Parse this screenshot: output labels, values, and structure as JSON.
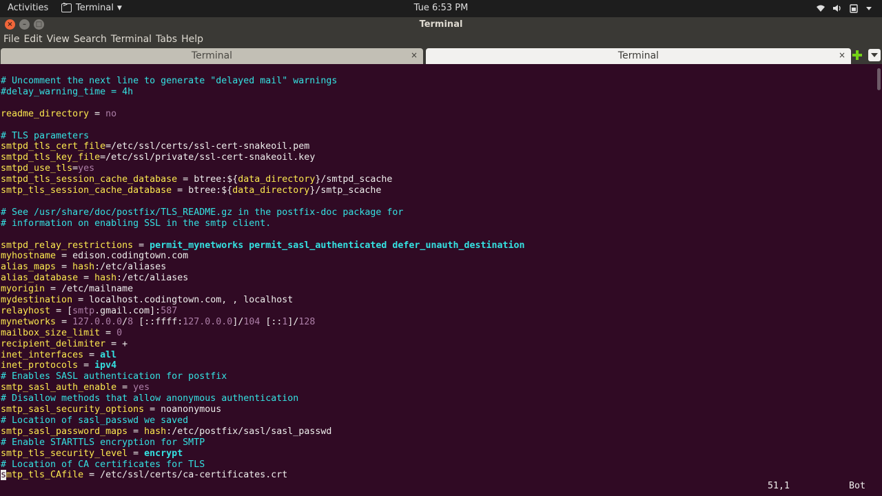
{
  "topbar": {
    "activities": "Activities",
    "app_name": "Terminal",
    "clock": "Tue  6:53 PM"
  },
  "window": {
    "title": "Terminal"
  },
  "menu": [
    "File",
    "Edit",
    "View",
    "Search",
    "Terminal",
    "Tabs",
    "Help"
  ],
  "tabs": [
    {
      "label": "Terminal",
      "active": false
    },
    {
      "label": "Terminal",
      "active": true
    }
  ],
  "editor": {
    "lines": [
      [
        [
          "c",
          "# Uncomment the next line to generate \"delayed mail\" warnings"
        ]
      ],
      [
        [
          "c",
          "#delay_warning_time = 4h"
        ]
      ],
      [],
      [
        [
          "k",
          "readme_directory"
        ],
        [
          "w",
          " = "
        ],
        [
          "g",
          "no"
        ]
      ],
      [],
      [
        [
          "c",
          "# TLS parameters"
        ]
      ],
      [
        [
          "k",
          "smtpd_tls_cert_file"
        ],
        [
          "w",
          "=/etc/ssl/certs/ssl-cert-snakeoil.pem"
        ]
      ],
      [
        [
          "k",
          "smtpd_tls_key_file"
        ],
        [
          "w",
          "=/etc/ssl/private/ssl-cert-snakeoil.key"
        ]
      ],
      [
        [
          "k",
          "smtpd_use_tls"
        ],
        [
          "w",
          "="
        ],
        [
          "g",
          "yes"
        ]
      ],
      [
        [
          "k",
          "smtpd_tls_session_cache_database"
        ],
        [
          "w",
          " = btree:${"
        ],
        [
          "k",
          "data_directory"
        ],
        [
          "w",
          "}/smtpd_scache"
        ]
      ],
      [
        [
          "k",
          "smtp_tls_session_cache_database"
        ],
        [
          "w",
          " = btree:${"
        ],
        [
          "k",
          "data_directory"
        ],
        [
          "w",
          "}/smtp_scache"
        ]
      ],
      [],
      [
        [
          "c",
          "# See /usr/share/doc/postfix/TLS_README.gz in the postfix-doc package for"
        ]
      ],
      [
        [
          "c",
          "# information on enabling SSL in the smtp client."
        ]
      ],
      [],
      [
        [
          "k",
          "smtpd_relay_restrictions"
        ],
        [
          "w",
          " = "
        ],
        [
          "bc",
          "permit_mynetworks permit_sasl_authenticated defer_unauth_destination"
        ]
      ],
      [
        [
          "k",
          "myhostname"
        ],
        [
          "w",
          " = edison.codingtown.com"
        ]
      ],
      [
        [
          "k",
          "alias_maps"
        ],
        [
          "w",
          " = "
        ],
        [
          "k",
          "hash"
        ],
        [
          "w",
          ":/etc/aliases"
        ]
      ],
      [
        [
          "k",
          "alias_database"
        ],
        [
          "w",
          " = "
        ],
        [
          "k",
          "hash"
        ],
        [
          "w",
          ":/etc/aliases"
        ]
      ],
      [
        [
          "k",
          "myorigin"
        ],
        [
          "w",
          " = /etc/mailname"
        ]
      ],
      [
        [
          "k",
          "mydestination"
        ],
        [
          "w",
          " = localhost.codingtown.com, , localhost"
        ]
      ],
      [
        [
          "k",
          "relayhost"
        ],
        [
          "w",
          " = ["
        ],
        [
          "g",
          "smtp"
        ],
        [
          "w",
          ".gmail.com]:"
        ],
        [
          "g",
          "587"
        ]
      ],
      [
        [
          "k",
          "mynetworks"
        ],
        [
          "w",
          " = "
        ],
        [
          "g",
          "127.0.0.0"
        ],
        [
          "w",
          "/"
        ],
        [
          "g",
          "8"
        ],
        [
          "w",
          " [::ffff:"
        ],
        [
          "g",
          "127.0.0.0"
        ],
        [
          "w",
          "]/"
        ],
        [
          "g",
          "104"
        ],
        [
          "w",
          " [::"
        ],
        [
          "g",
          "1"
        ],
        [
          "w",
          "]/"
        ],
        [
          "g",
          "128"
        ]
      ],
      [
        [
          "k",
          "mailbox_size_limit"
        ],
        [
          "w",
          " = "
        ],
        [
          "g",
          "0"
        ]
      ],
      [
        [
          "k",
          "recipient_delimiter"
        ],
        [
          "w",
          " = +"
        ]
      ],
      [
        [
          "k",
          "inet_interfaces"
        ],
        [
          "w",
          " = "
        ],
        [
          "bc",
          "all"
        ]
      ],
      [
        [
          "k",
          "inet_protocols"
        ],
        [
          "w",
          " = "
        ],
        [
          "bc",
          "ipv4"
        ]
      ],
      [
        [
          "c",
          "# Enables SASL authentication for postfix"
        ]
      ],
      [
        [
          "k",
          "smtp_sasl_auth_enable"
        ],
        [
          "w",
          " = "
        ],
        [
          "g",
          "yes"
        ]
      ],
      [
        [
          "c",
          "# Disallow methods that allow anonymous authentication"
        ]
      ],
      [
        [
          "k",
          "smtp_sasl_security_options"
        ],
        [
          "w",
          " = noanonymous"
        ]
      ],
      [
        [
          "c",
          "# Location of sasl_passwd we saved"
        ]
      ],
      [
        [
          "k",
          "smtp_sasl_password_maps"
        ],
        [
          "w",
          " = "
        ],
        [
          "k",
          "hash"
        ],
        [
          "w",
          ":/etc/postfix/sasl/sasl_passwd"
        ]
      ],
      [
        [
          "c",
          "# Enable STARTTLS encryption for SMTP"
        ]
      ],
      [
        [
          "k",
          "smtp_tls_security_level"
        ],
        [
          "w",
          " = "
        ],
        [
          "bc",
          "encrypt"
        ]
      ],
      [
        [
          "c",
          "# Location of CA certificates for TLS"
        ]
      ],
      [
        [
          "cur",
          "s"
        ],
        [
          "k",
          "mtp_tls_CAfile"
        ],
        [
          "w",
          " = /etc/ssl/certs/ca-certificates.crt"
        ]
      ]
    ],
    "cursor_pos": "51,1",
    "scroll_pos": "Bot"
  },
  "icons": {
    "wifi": "wifi-icon",
    "volume": "volume-icon",
    "battery": "battery-icon",
    "power": "power-caret-icon"
  }
}
